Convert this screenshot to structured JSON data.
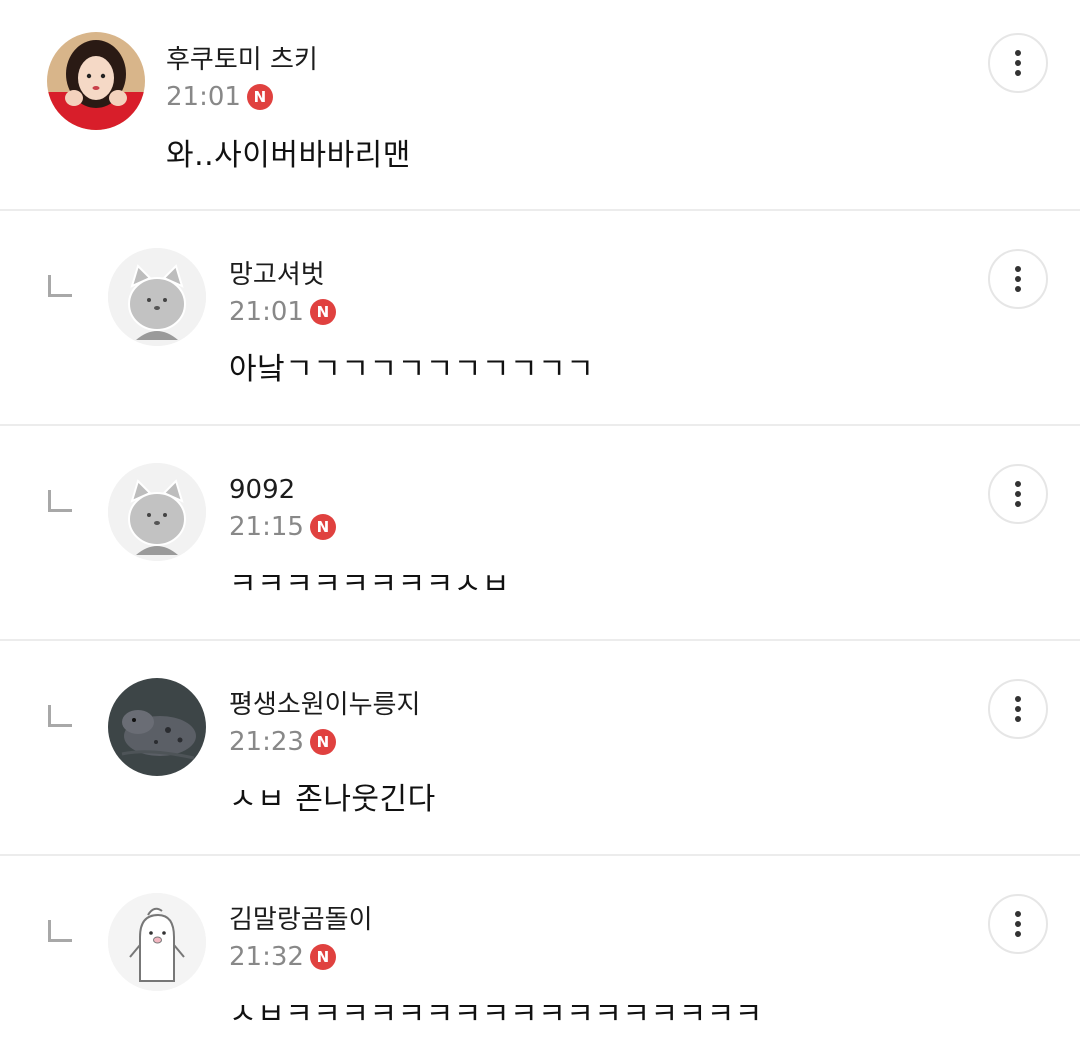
{
  "comments": [
    {
      "nickname": "후쿠토미 츠키",
      "time": "21:01",
      "new_badge": "N",
      "text": "와..사이버바바리맨",
      "is_reply": false,
      "avatar_icon": "profile-photo"
    },
    {
      "nickname": "망고셔벗",
      "time": "21:01",
      "new_badge": "N",
      "text": "아낰ㄱㄱㄱㄱㄱㄱㄱㄱㄱㄱㄱ",
      "is_reply": true,
      "avatar_icon": "default-cat-avatar"
    },
    {
      "nickname": "9092",
      "time": "21:15",
      "new_badge": "N",
      "text": "ㅋㅋㅋㅋㅋㅋㅋㅋㅅㅂ",
      "is_reply": true,
      "avatar_icon": "default-cat-avatar"
    },
    {
      "nickname": "평생소원이누릉지",
      "time": "21:23",
      "new_badge": "N",
      "text": "ㅅㅂ 존나웃긴다",
      "is_reply": true,
      "avatar_icon": "dog-photo-avatar"
    },
    {
      "nickname": "김말랑곰돌이",
      "time": "21:32",
      "new_badge": "N",
      "text": "ㅅㅂㅋㅋㅋㅋㅋㅋㅋㅋㅋㅋㅋㅋㅋㅋㅋㅋㅋ",
      "is_reply": true,
      "avatar_icon": "penguin-avatar"
    }
  ],
  "colors": {
    "new_badge": "#e0413f",
    "divider": "#ececec",
    "time": "#888888"
  }
}
